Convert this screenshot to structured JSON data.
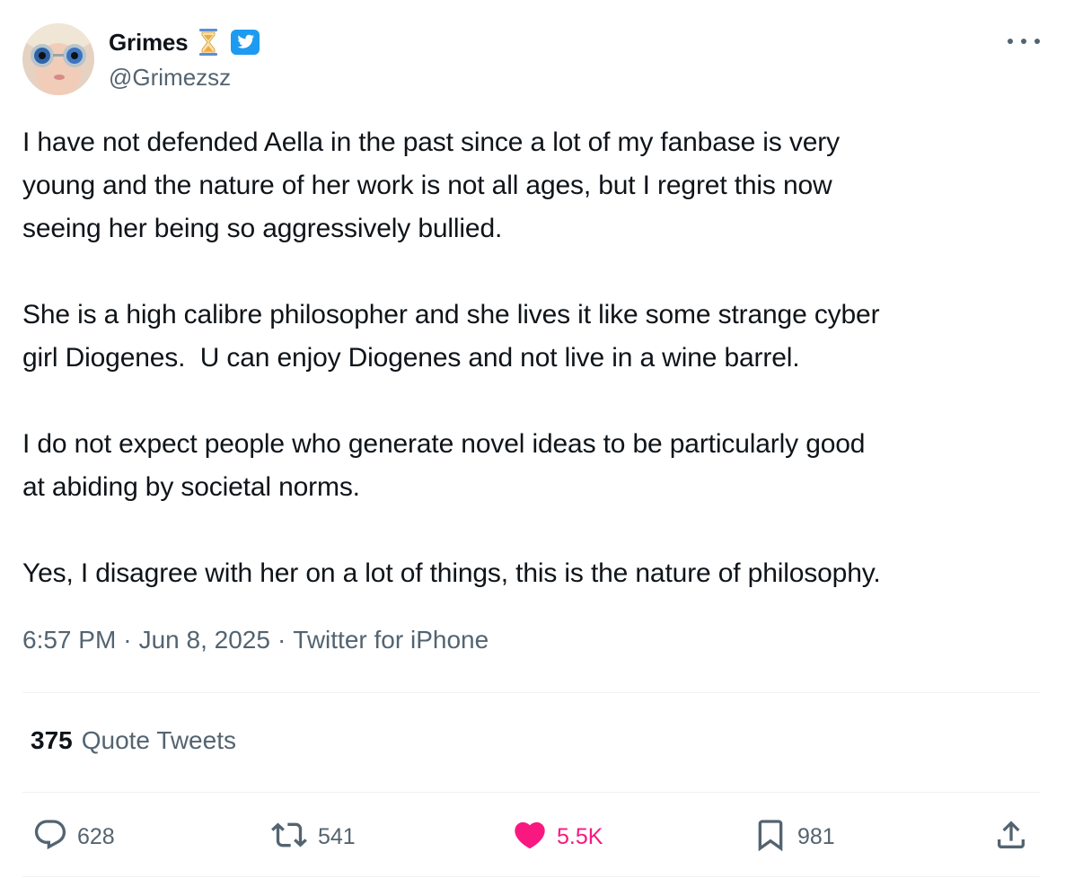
{
  "author": {
    "display_name": "Grimes",
    "handle": "@Grimezsz",
    "avatar": "avatar-photo",
    "badges": [
      "hourglass-icon",
      "verified-bird-icon"
    ]
  },
  "tweet": {
    "paragraphs": [
      [
        "I have not defended Aella in the past since a lot of my fanbase is very",
        "young and the nature of her work is not all ages, but I regret this now",
        "seeing her being so aggressively bullied."
      ],
      [
        "She is a high calibre philosopher and she lives it like some strange cyber",
        "girl Diogenes.  U can enjoy Diogenes and not live in a wine barrel."
      ],
      [
        "I do not expect people who generate novel ideas to be particularly good",
        "at abiding by societal norms."
      ],
      [
        "Yes, I disagree with her on a lot of things, this is the nature of philosophy."
      ]
    ],
    "time": "6:57 PM",
    "date": "Jun 8, 2025",
    "separator": "·",
    "source": "Twitter for iPhone"
  },
  "stats": {
    "quote_count": "375",
    "quote_label": "Quote Tweets"
  },
  "actions": {
    "replies": "628",
    "retweets": "541",
    "likes": "5.5K",
    "bookmarks": "981"
  },
  "colors": {
    "text": "#0f1419",
    "secondary": "#536471",
    "like": "#f91880",
    "verified": "#1d9bf0",
    "divider": "#eff3f4",
    "hourglass": "#f2a93b"
  }
}
